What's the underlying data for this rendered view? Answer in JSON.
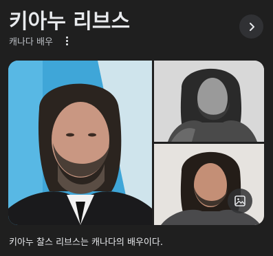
{
  "header": {
    "title": "키아누 리브스",
    "subtitle": "캐나다 배우"
  },
  "icons": {
    "more": "more-vert-icon",
    "next": "chevron-right-icon",
    "image_search": "image-icon"
  },
  "gallery": {
    "images": [
      {
        "name": "main-photo"
      },
      {
        "name": "top-right-photo"
      },
      {
        "name": "bottom-right-photo"
      }
    ]
  },
  "description": "키아누 찰스 리브스는 캐나다의 배우이다.",
  "colors": {
    "background": "#1f1f1f",
    "text_primary": "#e8eaed",
    "text_secondary": "#bdc1c6",
    "button_bg": "#303134"
  }
}
